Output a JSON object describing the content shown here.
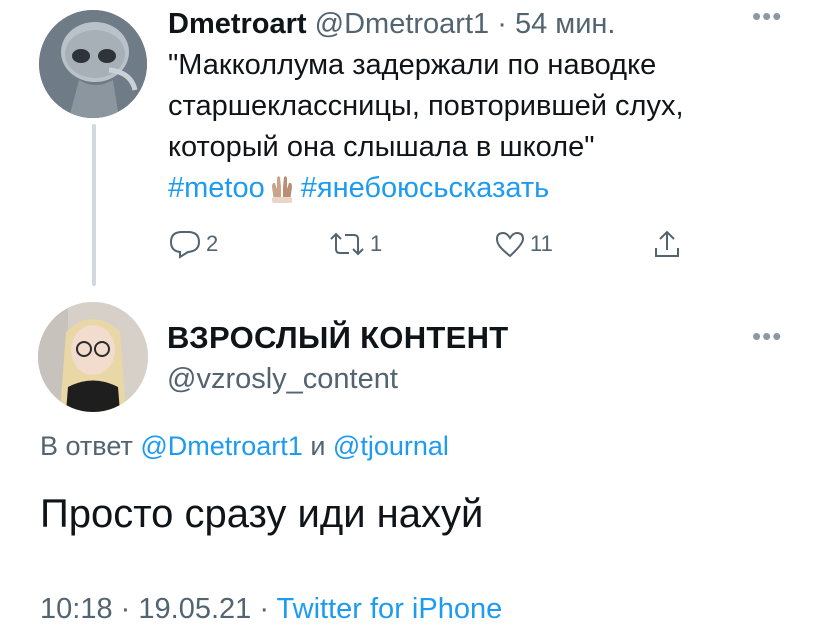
{
  "tweet1": {
    "author_name": "Dmetroart",
    "handle": "@Dmetroart1",
    "separator": "·",
    "time": "54 мин.",
    "text_lines": [
      "\"Макколлума задержали по наводке",
      "старшеклассницы, повторившей слух,",
      "который она слышала в школе\""
    ],
    "hashtags": [
      "#metoo",
      "#янебоюсьсказать"
    ],
    "reply_count": "2",
    "retweet_count": "1",
    "like_count": "11"
  },
  "tweet2": {
    "author_name": "ВЗРОСЛЫЙ КОНТЕНТ",
    "handle": "@vzrosly_content",
    "reply_prefix": "В ответ",
    "reply_to_1": "@Dmetroart1",
    "reply_conj": "и",
    "reply_to_2": "@tjournal",
    "text": "Просто сразу иди нахуй",
    "time": "10:18",
    "date": "19.05.21",
    "separator": "·",
    "source": "Twitter for iPhone"
  },
  "icons": {
    "more": "more-horizontal-icon",
    "reply": "reply-icon",
    "retweet": "retweet-icon",
    "like": "heart-icon",
    "share": "share-icon",
    "hashtag_emoji": "raised-hands-emoji"
  },
  "colors": {
    "link": "#1d9bf0",
    "muted": "#536471",
    "text": "#0f1419",
    "thread_line": "#cfd9de"
  }
}
